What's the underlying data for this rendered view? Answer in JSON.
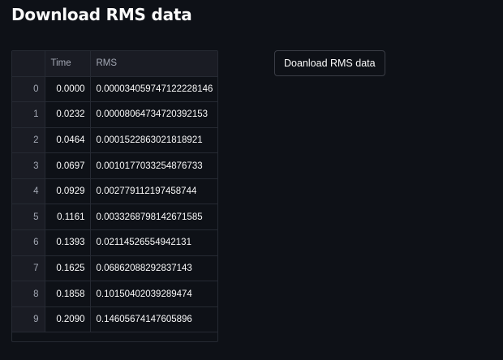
{
  "header": {
    "title": "Download RMS data"
  },
  "table": {
    "columns": [
      "",
      "Time",
      "RMS"
    ],
    "rows": [
      {
        "index": "0",
        "time": "0.0000",
        "rms": "0.000034059747122228146"
      },
      {
        "index": "1",
        "time": "0.0232",
        "rms": "0.00008064734720392153"
      },
      {
        "index": "2",
        "time": "0.0464",
        "rms": "0.0001522863021818921"
      },
      {
        "index": "3",
        "time": "0.0697",
        "rms": "0.0010177033254876733"
      },
      {
        "index": "4",
        "time": "0.0929",
        "rms": "0.002779112197458744"
      },
      {
        "index": "5",
        "time": "0.1161",
        "rms": "0.003326879814267158​5"
      },
      {
        "index": "6",
        "time": "0.1393",
        "rms": "0.02114526554942131"
      },
      {
        "index": "7",
        "time": "0.1625",
        "rms": "0.06862088292837143"
      },
      {
        "index": "8",
        "time": "0.1858",
        "rms": "0.10150402039289474"
      },
      {
        "index": "9",
        "time": "0.2090",
        "rms": "0.14605674147605896"
      }
    ]
  },
  "actions": {
    "download_label": "Doanload RMS data"
  }
}
